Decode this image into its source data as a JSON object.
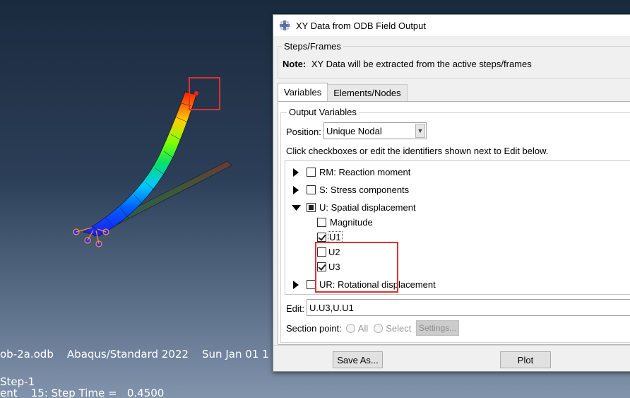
{
  "viewport": {
    "info_line": "ob-2a.odb    Abaqus/Standard 2022    Sun Jan 01 1",
    "step_line": "Step-1",
    "increment_line": "ent    15: Step Time =   0.4500"
  },
  "dialog": {
    "title": "XY Data from ODB Field Output",
    "title_icon": "abaqus-cross-icon",
    "steps_frames": {
      "group_label": "Steps/Frames",
      "note_label": "Note:",
      "note_text": "XY Data will be extracted from the active steps/frames"
    },
    "tabs": [
      {
        "label": "Variables",
        "active": true
      },
      {
        "label": "Elements/Nodes",
        "active": false
      }
    ],
    "output_variables": {
      "group_label": "Output Variables",
      "position_label": "Position:",
      "position_value": "Unique Nodal",
      "instruction": "Click checkboxes or edit the identifiers shown next to Edit below."
    },
    "tree": {
      "rm": {
        "label": "RM: Reaction moment",
        "state": "unchecked",
        "expanded": false
      },
      "s": {
        "label": "S: Stress components",
        "state": "unchecked",
        "expanded": false
      },
      "u": {
        "label": "U: Spatial displacement",
        "state": "partial",
        "expanded": true,
        "children": {
          "magnitude": {
            "label": "Magnitude",
            "state": "unchecked"
          },
          "u1": {
            "label": "U1",
            "state": "checked"
          },
          "u2": {
            "label": "U2",
            "state": "unchecked"
          },
          "u3": {
            "label": "U3",
            "state": "checked"
          }
        }
      },
      "ur": {
        "label": "UR: Rotational displacement",
        "state": "unchecked",
        "expanded": false
      }
    },
    "edit": {
      "label": "Edit:",
      "value": "U.U3,U.U1"
    },
    "section_point": {
      "label": "Section point:",
      "all_label": "All",
      "select_label": "Select",
      "settings_label": "Settings..."
    },
    "buttons": {
      "save_as": "Save As...",
      "plot": "Plot"
    },
    "colors": {
      "highlight": "#e03030",
      "dialog_bg": "#f0f0f0"
    }
  }
}
